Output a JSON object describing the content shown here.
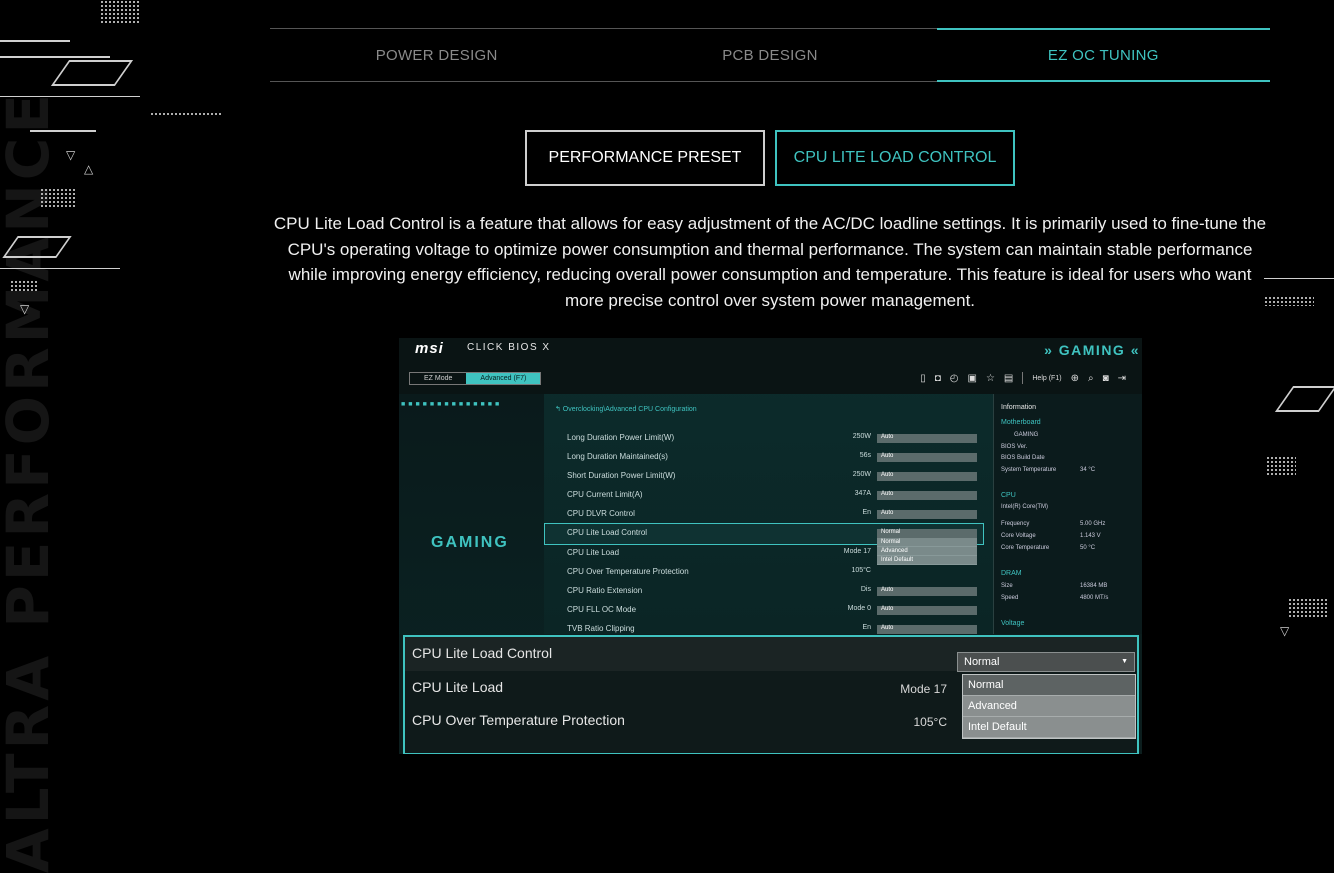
{
  "tabs": [
    {
      "label": "POWER DESIGN"
    },
    {
      "label": "PCB DESIGN"
    },
    {
      "label": "EZ OC TUNING"
    }
  ],
  "buttons": {
    "performance_preset": "PERFORMANCE PRESET",
    "cpu_lite_load_control": "CPU LITE LOAD CONTROL"
  },
  "description": "CPU Lite Load Control is a feature that allows for easy adjustment of the AC/DC loadline settings. It is primarily used to fine-tune the CPU's operating voltage to optimize power consumption and thermal performance. The system can maintain stable performance while improving energy efficiency, reducing overall power consumption and temperature. This feature is ideal for users who want more precise control over system power management.",
  "bios": {
    "logo": "msi",
    "product": "CLICK BIOS X",
    "brand": "» GAMING «",
    "mode_ez": "EZ Mode",
    "mode_adv": "Advanced (F7)",
    "help": "Help (F1)",
    "dots": "■■■■■■■■■■■■■■",
    "left_gaming": "GAMING",
    "path": "↰ Overclocking\\Advanced CPU Configuration",
    "rows": [
      {
        "label": "Long Duration Power Limit(W)",
        "value": "250W",
        "control": "Auto"
      },
      {
        "label": "Long Duration Maintained(s)",
        "value": "56s",
        "control": "Auto"
      },
      {
        "label": "Short Duration Power Limit(W)",
        "value": "250W",
        "control": "Auto"
      },
      {
        "label": "CPU Current Limit(A)",
        "value": "347A",
        "control": "Auto"
      },
      {
        "label": "CPU DLVR Control",
        "value": "En",
        "control": "Auto"
      },
      {
        "label": "CPU Lite Load Control",
        "value": "",
        "control": "Normal"
      },
      {
        "label": "CPU Lite Load",
        "value": "Mode 17",
        "control": ""
      },
      {
        "label": "CPU Over Temperature Protection",
        "value": "105°C",
        "control": ""
      },
      {
        "label": "CPU Ratio Extension",
        "value": "Dis",
        "control": "Auto"
      },
      {
        "label": "CPU FLL OC Mode",
        "value": "Mode 0",
        "control": "Auto"
      },
      {
        "label": "TVB Ratio Clipping",
        "value": "En",
        "control": "Auto"
      }
    ],
    "small_dropdown": [
      "Normal",
      "Advanced",
      "Intel Default"
    ],
    "info": {
      "title": "Information",
      "motherboard_h": "Motherboard",
      "motherboard": "GAMING",
      "bios_ver": "BIOS Ver.",
      "bios_build": "BIOS Build Date",
      "sys_temp": "System Temperature",
      "sys_temp_v": "34 °C",
      "cpu_h": "CPU",
      "cpu_name": "Intel(R) Core(TM)",
      "freq": "Frequency",
      "freq_v": "5.00 GHz",
      "core_v": "Core Voltage",
      "core_v_v": "1.143 V",
      "core_t": "Core Temperature",
      "core_t_v": "50 °C",
      "dram_h": "DRAM",
      "size": "Size",
      "size_v": "16384 MB",
      "speed": "Speed",
      "speed_v": "4800 MT/s",
      "voltage_h": "Voltage"
    }
  },
  "zoom": {
    "rows": [
      {
        "label": "CPU Lite Load Control",
        "value": ""
      },
      {
        "label": "CPU Lite Load",
        "value": "Mode 17"
      },
      {
        "label": "CPU Over Temperature Protection",
        "value": "105°C"
      }
    ],
    "selected": "Normal",
    "options": [
      "Normal",
      "Advanced",
      "Intel Default"
    ]
  },
  "decor_text": "ALTRA PERFORMANCE"
}
